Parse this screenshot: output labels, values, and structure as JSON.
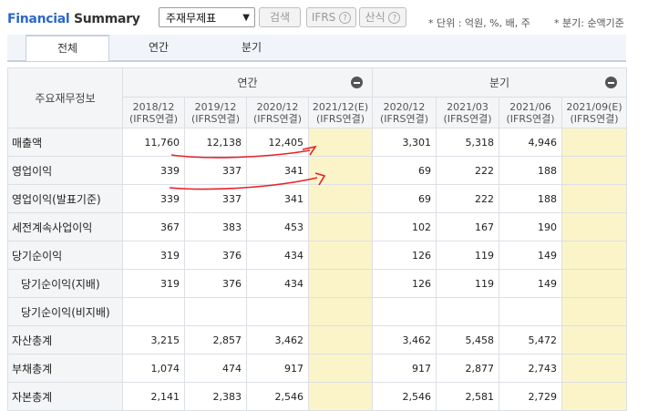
{
  "header": {
    "title_part1": "Financial",
    "title_part2": "Summary",
    "select_value": "주재무제표",
    "search_label": "검색",
    "ifrs_label": "IFRS",
    "formula_label": "산식",
    "help_label": "?",
    "unit_text": "* 단위 : 억원, %, 배, 주",
    "period_note": "* 분기: 순액기준"
  },
  "tabs": [
    "전체",
    "연간",
    "분기"
  ],
  "table": {
    "corner": "주요재무정보",
    "group_annual": "연간",
    "group_quarter": "분기",
    "columns": [
      {
        "date": "2018/12",
        "basis": "(IFRS연결)"
      },
      {
        "date": "2019/12",
        "basis": "(IFRS연결)"
      },
      {
        "date": "2020/12",
        "basis": "(IFRS연결)"
      },
      {
        "date": "2021/12(E)",
        "basis": "(IFRS연결)"
      },
      {
        "date": "2020/12",
        "basis": "(IFRS연결)"
      },
      {
        "date": "2021/03",
        "basis": "(IFRS연결)"
      },
      {
        "date": "2021/06",
        "basis": "(IFRS연결)"
      },
      {
        "date": "2021/09(E)",
        "basis": "(IFRS연결)"
      }
    ],
    "rows": [
      {
        "label": "매출액",
        "values": [
          "11,760",
          "12,138",
          "12,405",
          "",
          "3,301",
          "5,318",
          "4,946",
          ""
        ]
      },
      {
        "label": "영업이익",
        "values": [
          "339",
          "337",
          "341",
          "",
          "69",
          "222",
          "188",
          ""
        ]
      },
      {
        "label": "영업이익(발표기준)",
        "values": [
          "339",
          "337",
          "341",
          "",
          "69",
          "222",
          "188",
          ""
        ]
      },
      {
        "label": "세전계속사업이익",
        "values": [
          "367",
          "383",
          "453",
          "",
          "102",
          "167",
          "190",
          ""
        ]
      },
      {
        "label": "당기순이익",
        "values": [
          "319",
          "376",
          "434",
          "",
          "126",
          "119",
          "149",
          ""
        ]
      },
      {
        "label": "당기순이익(지배)",
        "values": [
          "319",
          "376",
          "434",
          "",
          "126",
          "119",
          "149",
          ""
        ]
      },
      {
        "label": "당기순이익(비지배)",
        "values": [
          "",
          "",
          "",
          "",
          "",
          "",
          "",
          ""
        ]
      },
      {
        "label": "자산총계",
        "values": [
          "3,215",
          "2,857",
          "3,462",
          "",
          "3,462",
          "5,458",
          "5,472",
          ""
        ]
      },
      {
        "label": "부채총계",
        "values": [
          "1,074",
          "474",
          "917",
          "",
          "917",
          "2,877",
          "2,743",
          ""
        ]
      },
      {
        "label": "자본총계",
        "values": [
          "2,141",
          "2,383",
          "2,546",
          "",
          "2,546",
          "2,581",
          "2,729",
          ""
        ]
      }
    ]
  },
  "colors": {
    "accent": "#2b67c9",
    "estimate_bg": "#fbf4c9",
    "annotation": "#e8222a"
  }
}
